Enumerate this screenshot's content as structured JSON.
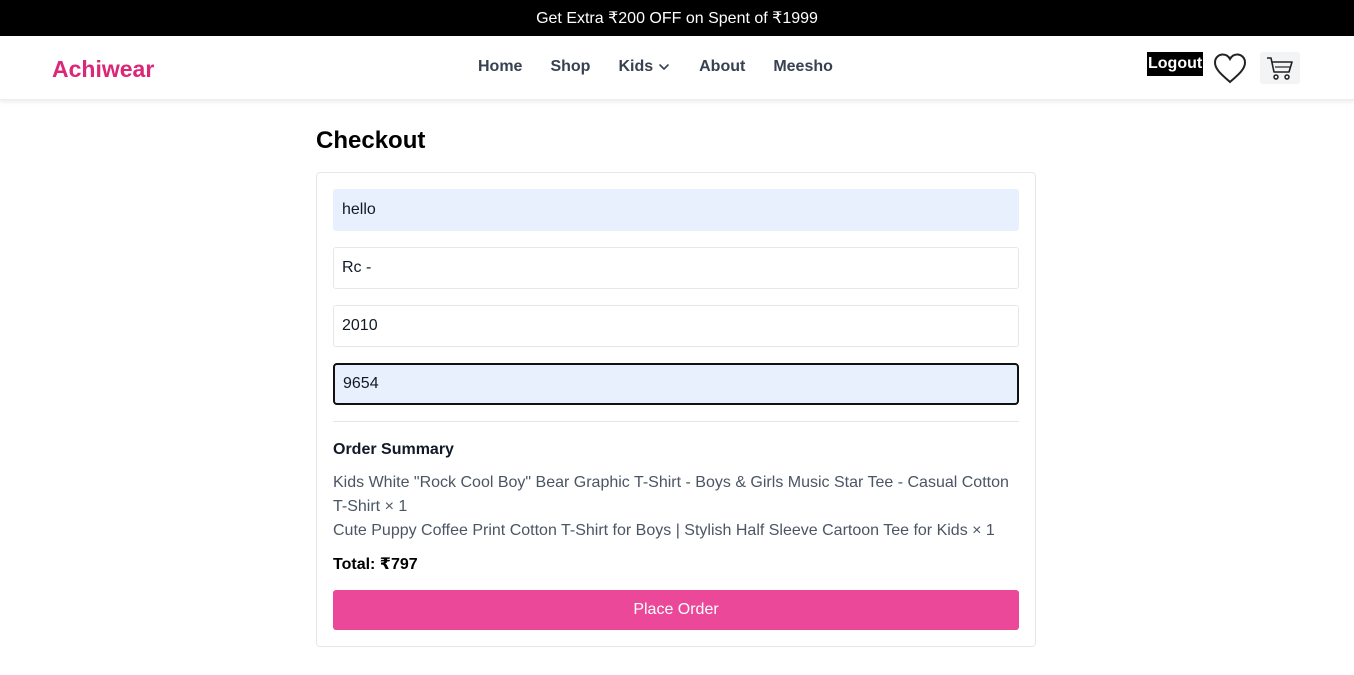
{
  "promo": {
    "text": "Get Extra ₹200 OFF on Spent of ₹1999"
  },
  "header": {
    "brand": "Achiwear",
    "nav": [
      "Home",
      "Shop",
      "Kids",
      "About",
      "Meesho"
    ],
    "logout_label": "Logout",
    "icons": {
      "wishlist": "heart-icon",
      "cart": "cart-icon",
      "dropdown": "chevron-down-icon"
    }
  },
  "page": {
    "title": "Checkout"
  },
  "form": {
    "fields": [
      {
        "value": "hello"
      },
      {
        "value": "Rc -"
      },
      {
        "value": "2010"
      },
      {
        "value": "9654"
      }
    ]
  },
  "summary": {
    "title": "Order Summary",
    "items": [
      "Kids White \"Rock Cool Boy\" Bear Graphic T-Shirt - Boys & Girls Music Star Tee - Casual Cotton T-Shirt × 1",
      "Cute Puppy Coffee Print Cotton T-Shirt for Boys | Stylish Half Sleeve Cartoon Tee for Kids × 1"
    ],
    "total": "Total: ₹797"
  },
  "actions": {
    "place_order": "Place Order"
  },
  "colors": {
    "brand": "#db2777",
    "button": "#ec4899",
    "autofill": "#e8f0fe"
  }
}
